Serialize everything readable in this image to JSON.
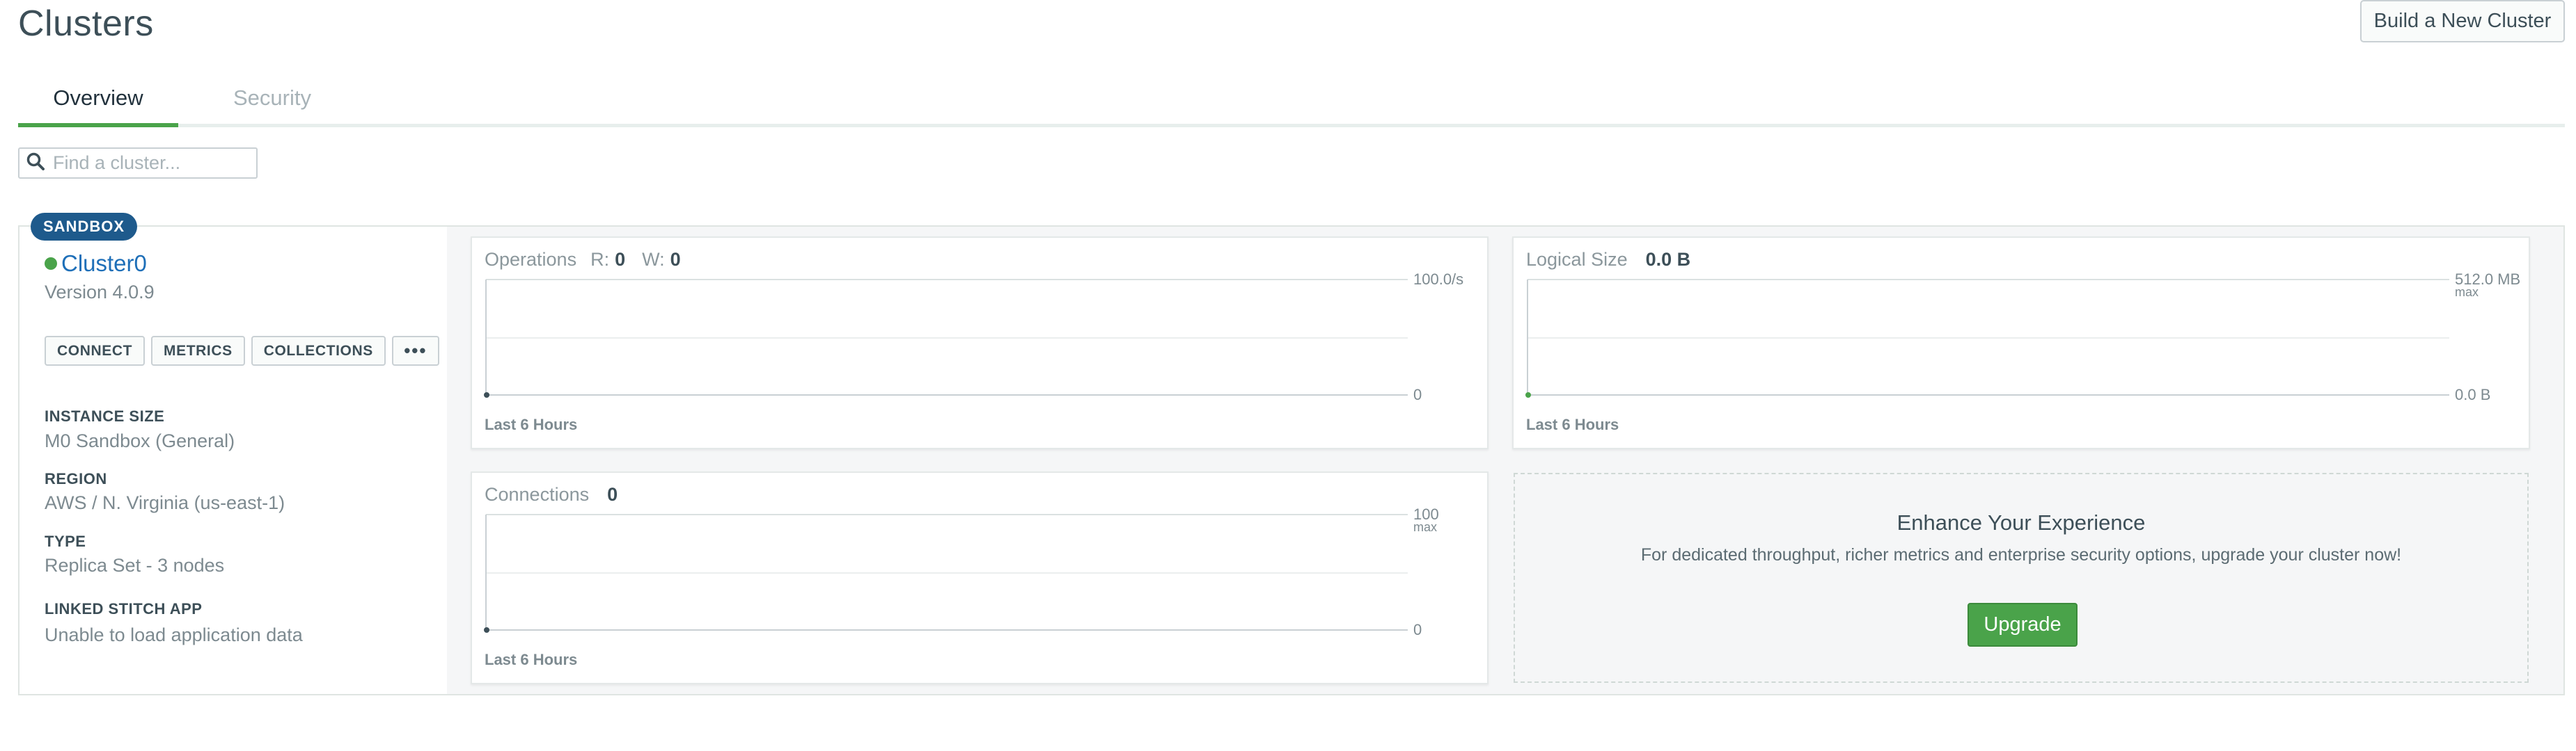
{
  "header": {
    "title": "Clusters",
    "build_button": "Build a New Cluster"
  },
  "tabs": [
    {
      "label": "Overview",
      "active": true
    },
    {
      "label": "Security",
      "active": false
    }
  ],
  "search": {
    "placeholder": "Find a cluster...",
    "icon": "search-icon"
  },
  "cluster": {
    "badge": "SANDBOX",
    "name": "Cluster0",
    "status_color": "#4aa34a",
    "version": "Version 4.0.9",
    "actions": {
      "connect": "CONNECT",
      "metrics": "METRICS",
      "collections": "COLLECTIONS",
      "more": "•••"
    },
    "properties": [
      {
        "label": "INSTANCE SIZE",
        "value": "M0 Sandbox (General)"
      },
      {
        "label": "REGION",
        "value": "AWS / N. Virginia (us-east-1)"
      },
      {
        "label": "TYPE",
        "value": "Replica Set - 3 nodes"
      },
      {
        "label": "LINKED STITCH APP",
        "value": "Unable to load application data"
      }
    ]
  },
  "panels": {
    "operations": {
      "label": "Operations",
      "r_label": "R:",
      "r_value": "0",
      "w_label": "W:",
      "w_value": "0",
      "axis_max": "100.0/s",
      "axis_min": "0",
      "footer": "Last 6 Hours"
    },
    "logical_size": {
      "label": "Logical Size",
      "value": "0.0 B",
      "axis_max": "512.0 MB",
      "axis_max_sub": "max",
      "axis_min": "0.0 B",
      "footer": "Last 6 Hours"
    },
    "connections": {
      "label": "Connections",
      "value": "0",
      "axis_max": "100",
      "axis_max_sub": "max",
      "axis_min": "0",
      "footer": "Last 6 Hours"
    }
  },
  "enhance": {
    "title": "Enhance Your Experience",
    "text": "For dedicated throughput, richer metrics and enterprise security options, upgrade your cluster now!",
    "button": "Upgrade"
  },
  "colors": {
    "accent_green": "#4aa34a",
    "link_blue": "#1e6fb8",
    "badge_blue": "#1e5a8c"
  }
}
